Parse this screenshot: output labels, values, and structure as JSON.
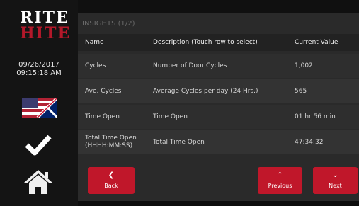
{
  "logo": {
    "line1": "RITE",
    "line2": "HITE"
  },
  "datetime": {
    "date": "09/26/2017",
    "time": "09:15:18 AM"
  },
  "icons": {
    "flag": "us-uk-flag-icon",
    "check": "checkmark-icon",
    "home": "home-icon"
  },
  "panel": {
    "title": "INSIGHTS (1/2)"
  },
  "table": {
    "headers": [
      "Name",
      "Description (Touch row to select)",
      "Current Value"
    ],
    "rows": [
      {
        "name": "Cycles",
        "description": "Number of Door Cycles",
        "value": "1,002"
      },
      {
        "name": "Ave. Cycles",
        "description": "Average Cycles per day (24 Hrs.)",
        "value": "565"
      },
      {
        "name": "Time Open",
        "description": "Time Open",
        "value": "01 hr 56 min"
      },
      {
        "name_line1": "Total Time Open",
        "name_line2": "(HHHH:MM:SS)",
        "description": "Total Time Open",
        "value": "47:34:32"
      }
    ]
  },
  "buttons": {
    "back": "Back",
    "previous": "Previous",
    "next": "Next"
  },
  "colors": {
    "accent": "#c0172a",
    "panel": "#2a2a2a",
    "text": "#d8d8d8"
  }
}
